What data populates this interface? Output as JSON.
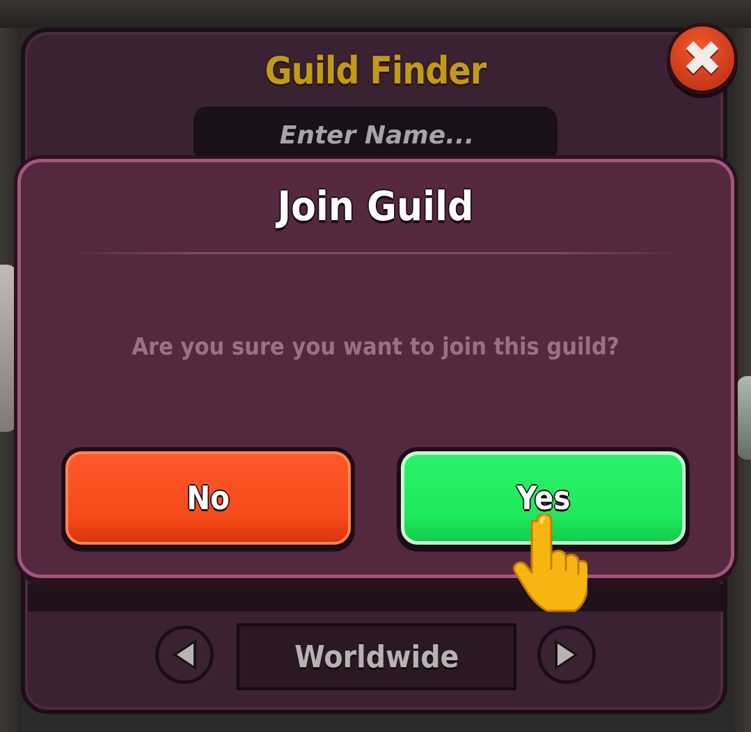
{
  "finder": {
    "title": "Guild Finder",
    "search_placeholder": "Enter Name...",
    "region": "Worldwide"
  },
  "dialog": {
    "title": "Join Guild",
    "message": "Are you sure you want to join this guild?",
    "no_label": "No",
    "yes_label": "Yes"
  },
  "icons": {
    "close": "close-icon",
    "prev": "arrow-left-icon",
    "next": "arrow-right-icon",
    "hint": "pointing-hand-icon"
  },
  "colors": {
    "panel": "#3a2233",
    "dialog": "#54293f",
    "dialog_border": "#a5557e",
    "title_gold": "#c29a1a",
    "no_button": "#f64a1a",
    "yes_button": "#1ee85c",
    "close_button": "#d8401f"
  }
}
